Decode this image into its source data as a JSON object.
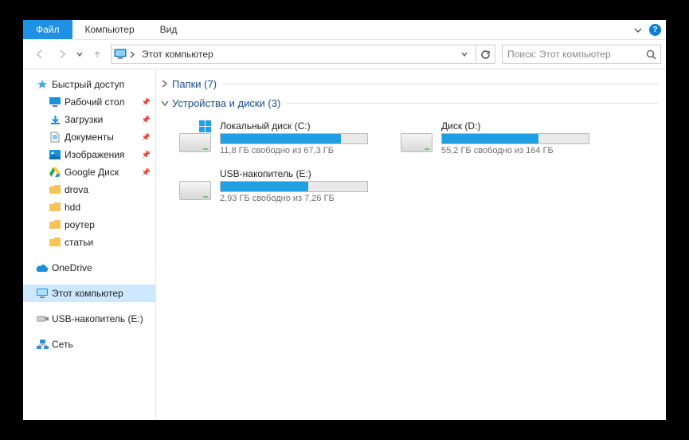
{
  "menu": {
    "file": "Файл",
    "computer": "Компьютер",
    "view": "Вид"
  },
  "address": {
    "location": "Этот компьютер"
  },
  "search": {
    "placeholder": "Поиск: Этот компьютер"
  },
  "sidebar": {
    "quick_access": "Быстрый доступ",
    "desktop": "Рабочий стол",
    "downloads": "Загрузки",
    "documents": "Документы",
    "pictures": "Изображения",
    "gdrive": "Google Диск",
    "drova": "drova",
    "hdd": "hdd",
    "router": "роутер",
    "articles": "статьи",
    "onedrive": "OneDrive",
    "this_pc": "Этот компьютер",
    "usb": "USB-накопитель (E:)",
    "network": "Сеть"
  },
  "groups": {
    "folders": {
      "label": "Папки (7)"
    },
    "drives": {
      "label": "Устройства и диски (3)"
    }
  },
  "drives": [
    {
      "name": "Локальный диск (C:)",
      "sub": "11,8 ГБ свободно из 67,3 ГБ",
      "fill_pct": 82,
      "badge": "windows"
    },
    {
      "name": "Диск (D:)",
      "sub": "55,2 ГБ свободно из 164 ГБ",
      "fill_pct": 66,
      "badge": null
    },
    {
      "name": "USB-накопитель (E:)",
      "sub": "2,93 ГБ свободно из 7,26 ГБ",
      "fill_pct": 60,
      "badge": null
    }
  ]
}
